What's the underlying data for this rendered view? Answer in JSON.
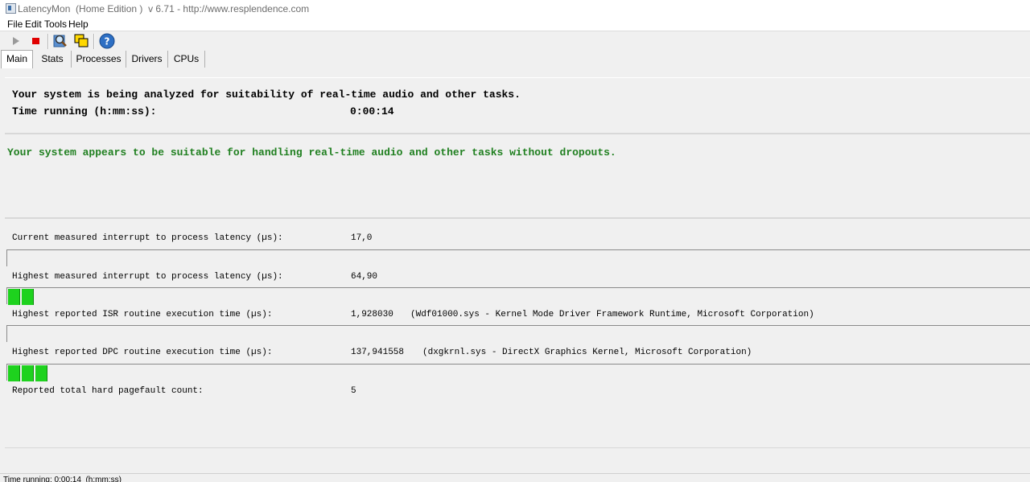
{
  "window": {
    "title": "LatencyMon  (Home Edition )  v 6.71 - http://www.resplendence.com"
  },
  "menu": {
    "file": "File",
    "edit": "Edit",
    "tools": "Tools",
    "help": "Help"
  },
  "toolbar": {
    "play_icon": "play-icon",
    "stop_icon": "stop-icon",
    "search_icon": "magnifier-icon",
    "windows_icon": "windows-icon",
    "help_icon": "help-icon"
  },
  "tabs": [
    "Main",
    "Stats",
    "Processes",
    "Drivers",
    "CPUs"
  ],
  "analysis": {
    "heading": "Your system is being analyzed for suitability of real-time audio and other tasks.",
    "time_label": "Time running (h:mm:ss):",
    "time_value": "0:00:14"
  },
  "verdict": {
    "text": "Your system appears to be suitable for handling real-time audio and other tasks without dropouts.",
    "color": "#1f7f1f"
  },
  "metrics": {
    "current_label": "Current measured interrupt to process latency (µs):",
    "current_value": "17,0",
    "current_bar_segments": 0,
    "highest_label": "Highest measured interrupt to process latency (µs):",
    "highest_value": "64,90",
    "highest_bar_segments": 2,
    "isr_label": "Highest reported ISR routine execution time (µs):",
    "isr_value": "1,928030",
    "isr_detail": "(Wdf01000.sys - Kernel Mode Driver Framework Runtime, Microsoft Corporation)",
    "isr_bar_segments": 0,
    "dpc_label": "Highest reported DPC routine execution time (µs):",
    "dpc_value": "137,941558",
    "dpc_detail": "(dxgkrnl.sys - DirectX Graphics Kernel, Microsoft Corporation)",
    "dpc_bar_segments": 3,
    "pagefault_label": "Reported total hard pagefault count:",
    "pagefault_value": "5",
    "bar_color": "#1ed21e"
  },
  "status": {
    "text": "Time running: 0:00:14  (h:mm:ss)"
  }
}
